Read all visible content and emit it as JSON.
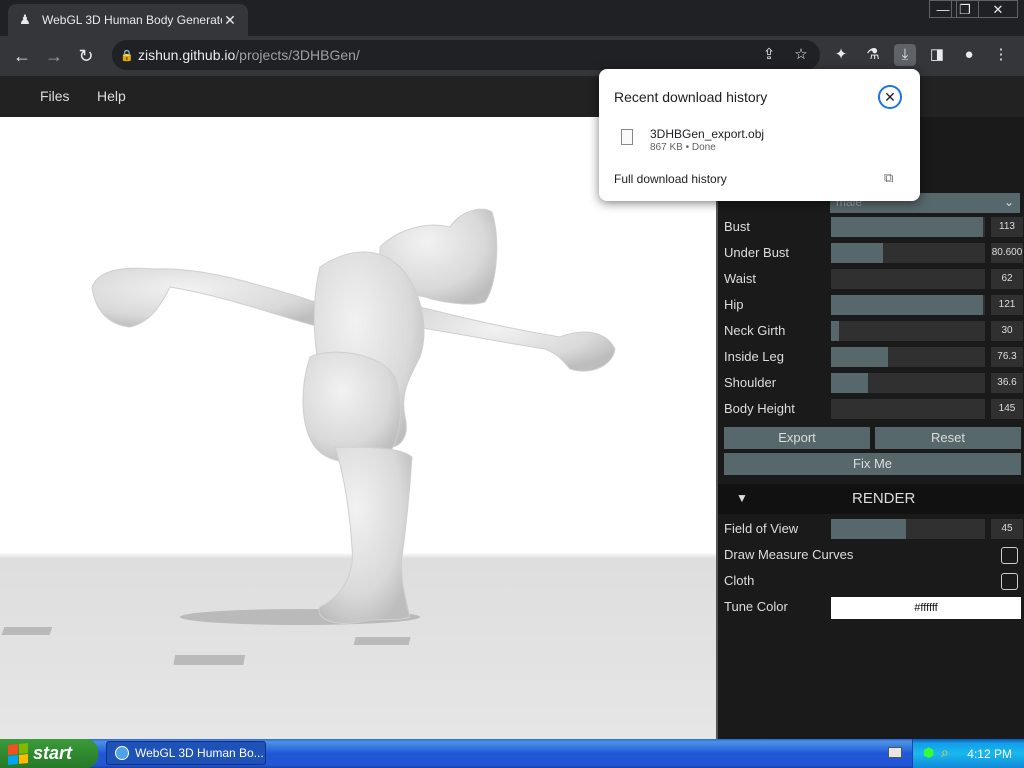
{
  "browser": {
    "tab_title": "WebGL 3D Human Body Generator",
    "tab_close": "✕",
    "url_host": "zishun.github.io",
    "url_path": "/projects/3DHBGen/",
    "window_controls": [
      "—",
      "❐",
      "✕"
    ]
  },
  "menu": {
    "files": "Files",
    "help": "Help"
  },
  "download_popup": {
    "title": "Recent download history",
    "file_name": "3DHBGen_export.obj",
    "file_meta": "867 KB • Done",
    "full_history": "Full download history"
  },
  "panel": {
    "behind_popup_fragment": "n)",
    "gender_select": "male",
    "sliders": [
      {
        "label": "Bust",
        "value": "113",
        "fill": 0.99
      },
      {
        "label": "Under Bust",
        "value": "80.600",
        "fill": 0.34
      },
      {
        "label": "Waist",
        "value": "62",
        "fill": 0.0
      },
      {
        "label": "Hip",
        "value": "121",
        "fill": 0.99
      },
      {
        "label": "Neck Girth",
        "value": "30",
        "fill": 0.05
      },
      {
        "label": "Inside Leg",
        "value": "76.3",
        "fill": 0.37
      },
      {
        "label": "Shoulder",
        "value": "36.6",
        "fill": 0.24
      },
      {
        "label": "Body Height",
        "value": "145",
        "fill": 0.0
      }
    ],
    "export_btn": "Export",
    "reset_btn": "Reset",
    "fixme_btn": "Fix Me",
    "render_header": "RENDER",
    "render_arrow": "▼",
    "fov": {
      "label": "Field of View",
      "value": "45",
      "fill": 0.49
    },
    "draw_curves": "Draw Measure Curves",
    "cloth": "Cloth",
    "tune_color_label": "Tune Color",
    "tune_color_value": "#ffffff"
  },
  "taskbar": {
    "start": "start",
    "task_title": "WebGL 3D Human Bo...",
    "clock": "4:12 PM"
  },
  "colors": {
    "slider_fill": "#56686b",
    "panel_bg": "#1a1a1a",
    "chrome_dark": "#202124",
    "xp_blue": "#2157d7"
  }
}
